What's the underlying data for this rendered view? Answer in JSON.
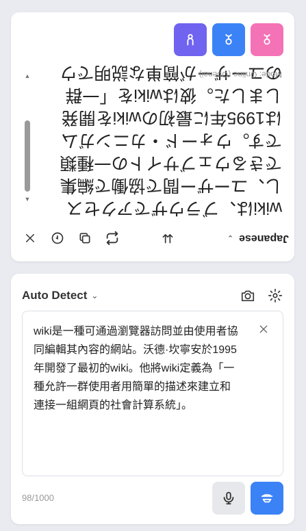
{
  "output": {
    "mode_label": "Mode: Online (Openai)",
    "translated_text": "wikiは、ブラウザでアクセスし、ユーザー間で協働で編集できるウェブサイトの一種類です。ウォード・カニンガムは1995年に最初のwikiを開発しました。彼はwikiを「一群のユーザーが簡単な説明でウェ",
    "language": "Japanese",
    "colors": {
      "btn1": "#6f63f0",
      "btn2": "#3b82f6",
      "btn3": "#f472b6"
    }
  },
  "input": {
    "language_label": "Auto Detect",
    "source_text": "wiki是一種可通過瀏覽器訪問並由使用者協同編輯其內容的網站。沃德·坎寧安於1995年開發了最初的wiki。他將wiki定義為「一種允許一群使用者用簡單的描述來建立和連接一組網頁的社會計算系統」。",
    "char_count": "98/1000"
  }
}
